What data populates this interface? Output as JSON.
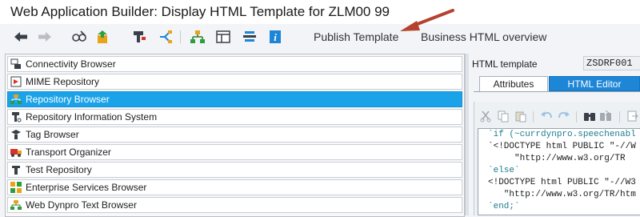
{
  "window": {
    "title": "Web Application Builder: Display HTML Template for ZLM00 99"
  },
  "toolbar": {
    "icons": [
      "back-icon",
      "forward-icon",
      "display-change-icon",
      "activate-icon",
      "where-used-icon",
      "navigation-icon",
      "hierarchy-icon",
      "layout-icon",
      "pretty-printer-icon",
      "info-icon"
    ],
    "publish_label": "Publish Template",
    "business_html_label": "Business HTML overview"
  },
  "object_browsers": {
    "selected_index": 2,
    "items": [
      {
        "label": "Connectivity Browser",
        "icon": "connectivity-icon"
      },
      {
        "label": "MIME Repository",
        "icon": "mime-icon"
      },
      {
        "label": "Repository Browser",
        "icon": "repository-icon"
      },
      {
        "label": "Repository Information System",
        "icon": "info-system-icon"
      },
      {
        "label": "Tag Browser",
        "icon": "tag-icon"
      },
      {
        "label": "Transport Organizer",
        "icon": "transport-icon"
      },
      {
        "label": "Test Repository",
        "icon": "test-icon"
      },
      {
        "label": "Enterprise Services Browser",
        "icon": "enterprise-services-icon"
      },
      {
        "label": "Web Dynpro Text Browser",
        "icon": "web-dynpro-icon"
      }
    ]
  },
  "template": {
    "label": "HTML template",
    "value": "ZSDRF001",
    "tabs": {
      "attributes": "Attributes",
      "html_editor": "HTML Editor"
    },
    "active_tab": "HTML Editor",
    "editor_icons": [
      "cut-icon",
      "copy-icon",
      "paste-icon",
      "undo-icon",
      "redo-icon",
      "find-icon",
      "find-next-icon",
      "insert-icon"
    ],
    "code_lines": [
      {
        "text": "`if (~currdynpro.speechenabl",
        "color": "#1d7c8e"
      },
      {
        "text": "`<!DOCTYPE html PUBLIC \"-//W",
        "color": "#1d1d1d"
      },
      {
        "text": "     \"http://www.w3.org/TR",
        "color": "#1d1d1d"
      },
      {
        "text": "`else`",
        "color": "#1d7c8e"
      },
      {
        "text": "<!DOCTYPE html PUBLIC \"-//W3",
        "color": "#1d1d1d"
      },
      {
        "text": "   \"http://www.w3.org/TR/htm",
        "color": "#1d1d1d"
      },
      {
        "text": "`end;`",
        "color": "#1d7c8e"
      }
    ]
  },
  "colors": {
    "selected": "#1aa3e8",
    "tab_active": "#1d86d6",
    "annotation_arrow": "#b5412e"
  }
}
